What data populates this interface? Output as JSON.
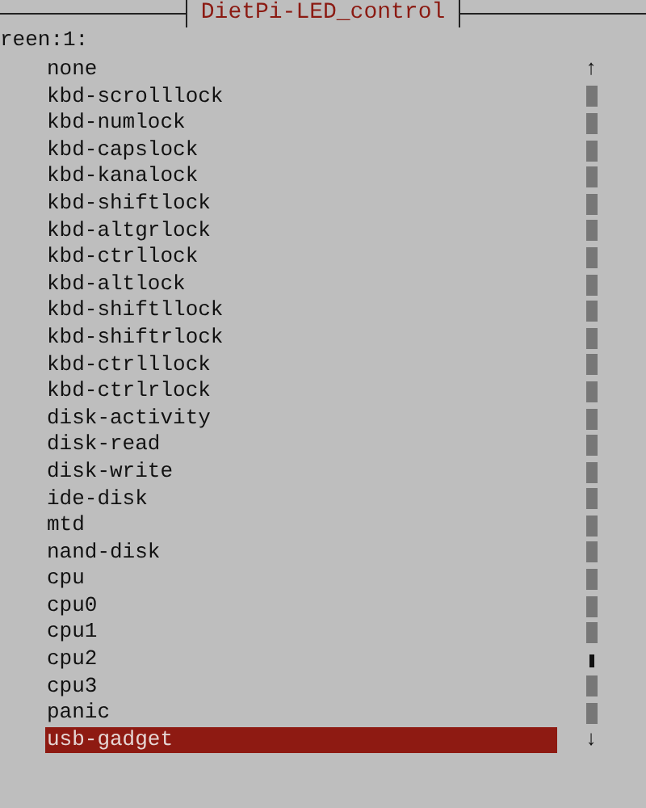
{
  "window": {
    "title": "DietPi-LED_control"
  },
  "prompt": "reen:1:",
  "items": [
    {
      "label": "none",
      "selected": false
    },
    {
      "label": "kbd-scrolllock",
      "selected": false
    },
    {
      "label": "kbd-numlock",
      "selected": false
    },
    {
      "label": "kbd-capslock",
      "selected": false
    },
    {
      "label": "kbd-kanalock",
      "selected": false
    },
    {
      "label": "kbd-shiftlock",
      "selected": false
    },
    {
      "label": "kbd-altgrlock",
      "selected": false
    },
    {
      "label": "kbd-ctrllock",
      "selected": false
    },
    {
      "label": "kbd-altlock",
      "selected": false
    },
    {
      "label": "kbd-shiftllock",
      "selected": false
    },
    {
      "label": "kbd-shiftrlock",
      "selected": false
    },
    {
      "label": "kbd-ctrlllock",
      "selected": false
    },
    {
      "label": "kbd-ctrlrlock",
      "selected": false
    },
    {
      "label": "disk-activity",
      "selected": false
    },
    {
      "label": "disk-read",
      "selected": false
    },
    {
      "label": "disk-write",
      "selected": false
    },
    {
      "label": "ide-disk",
      "selected": false
    },
    {
      "label": "mtd",
      "selected": false
    },
    {
      "label": "nand-disk",
      "selected": false
    },
    {
      "label": "cpu",
      "selected": false
    },
    {
      "label": "cpu0",
      "selected": false
    },
    {
      "label": "cpu1",
      "selected": false
    },
    {
      "label": "cpu2",
      "selected": false
    },
    {
      "label": "cpu3",
      "selected": false
    },
    {
      "label": "panic",
      "selected": false
    },
    {
      "label": "usb-gadget",
      "selected": true
    }
  ],
  "scrollbar": {
    "up": "↑",
    "down": "↓"
  }
}
